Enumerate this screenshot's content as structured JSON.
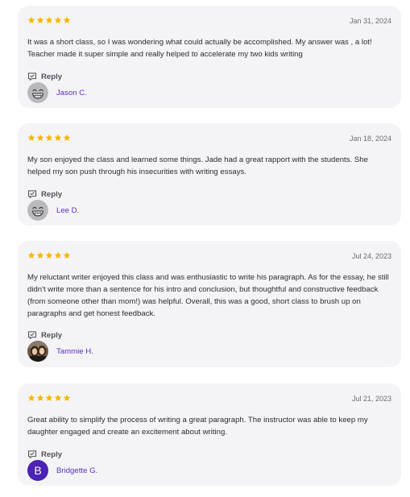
{
  "colors": {
    "star": "#f5b700",
    "author_name": "#5b2fc0",
    "avatar_letter_bg": "#4b22b5",
    "card_bg": "#f4f4f6"
  },
  "reviews": [
    {
      "rating": 5,
      "date": "Jan 31, 2024",
      "text": "It was a short class, so I was wondering what could actually be accomplished.  My answer was , a lot! Teacher made it super simple and really helped to accelerate my two kids writing",
      "reply_label": "Reply",
      "author": "Jason C.",
      "avatar": "smiley-face-icon"
    },
    {
      "rating": 5,
      "date": "Jan 18, 2024",
      "text": "My son enjoyed the class and learned some things. Jade had a great rapport with the students. She helped my son push through his insecurities with writing essays.",
      "reply_label": "Reply",
      "author": "Lee D.",
      "avatar": "smiley-face-icon"
    },
    {
      "rating": 5,
      "date": "Jul 24, 2023",
      "text": "My reluctant writer enjoyed this class and was enthusiastic to write his paragraph. As for the essay, he still didn't write more than a sentence for his intro and conclusion, but thoughtful and constructive feedback (from someone other than mom!) was helpful. Overall, this was a good, short class to brush up on paragraphs and get honest feedback.",
      "reply_label": "Reply",
      "author": "Tammie H.",
      "avatar": "profile-photo"
    },
    {
      "rating": 5,
      "date": "Jul 21, 2023",
      "text": "Great ability to simplify the process of writing a great paragraph. The instructor was able to keep my daughter engaged and create an excitement about writing.",
      "reply_label": "Reply",
      "author": "Bridgette G.",
      "avatar": "letter-avatar",
      "avatar_letter": "B"
    }
  ]
}
